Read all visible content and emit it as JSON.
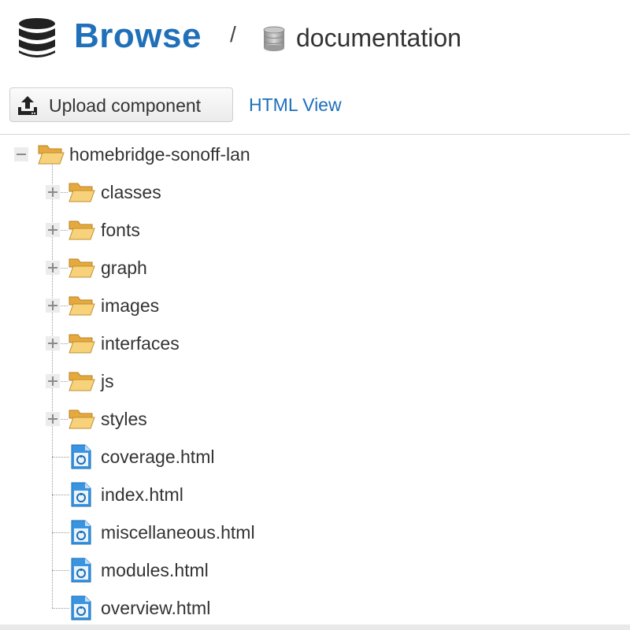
{
  "header": {
    "title": "Browse",
    "separator": "/",
    "repository": "documentation"
  },
  "toolbar": {
    "upload_label": "Upload component",
    "html_view_label": "HTML View"
  },
  "tree": {
    "root": {
      "label": "homebridge-sonoff-lan",
      "expanded": true,
      "icon": "folder-open-icon"
    },
    "folders": [
      {
        "label": "classes"
      },
      {
        "label": "fonts"
      },
      {
        "label": "graph"
      },
      {
        "label": "images"
      },
      {
        "label": "interfaces"
      },
      {
        "label": "js"
      },
      {
        "label": "styles"
      }
    ],
    "files": [
      {
        "label": "coverage.html"
      },
      {
        "label": "index.html"
      },
      {
        "label": "miscellaneous.html"
      },
      {
        "label": "modules.html"
      },
      {
        "label": "overview.html"
      }
    ]
  },
  "colors": {
    "accent": "#1f6fb9",
    "folder": "#f3c462",
    "file": "#2f8fdc"
  }
}
